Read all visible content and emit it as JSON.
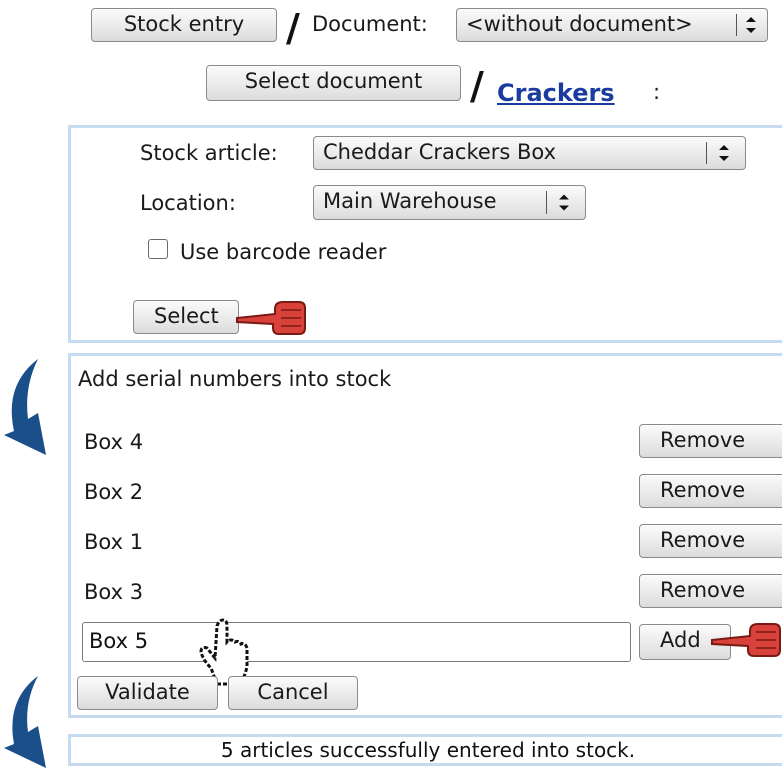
{
  "header": {
    "stock_entry_button": "Stock entry",
    "document_label": "Document:",
    "document_select": "<without document>",
    "select_document_button": "Select document",
    "link_crackers": "Crackers",
    "colon": ":"
  },
  "selection_panel": {
    "stock_article_label": "Stock article:",
    "stock_article_value": "Cheddar Crackers Box",
    "location_label": "Location:",
    "location_value": "Main Warehouse",
    "barcode_label": "Use barcode reader",
    "barcode_checked": false,
    "select_button": "Select"
  },
  "serial_panel": {
    "title": "Add serial numbers into stock",
    "items": [
      {
        "name": "Box 4",
        "remove_label": "Remove"
      },
      {
        "name": "Box 2",
        "remove_label": "Remove"
      },
      {
        "name": "Box 1",
        "remove_label": "Remove"
      },
      {
        "name": "Box 3",
        "remove_label": "Remove"
      }
    ],
    "input_value": "Box 5",
    "add_button": "Add",
    "validate_button": "Validate",
    "cancel_button": "Cancel"
  },
  "status": {
    "message": "5 articles successfully entered into stock."
  },
  "colors": {
    "panel_border": "#c6dbef",
    "link": "#1a3c9e",
    "flow_arrow": "#1b4f8a",
    "pointer_hand": "#d9423a"
  },
  "icons": [
    "pointing-hand-icon",
    "hand-cursor-icon",
    "curved-arrow-icon"
  ]
}
